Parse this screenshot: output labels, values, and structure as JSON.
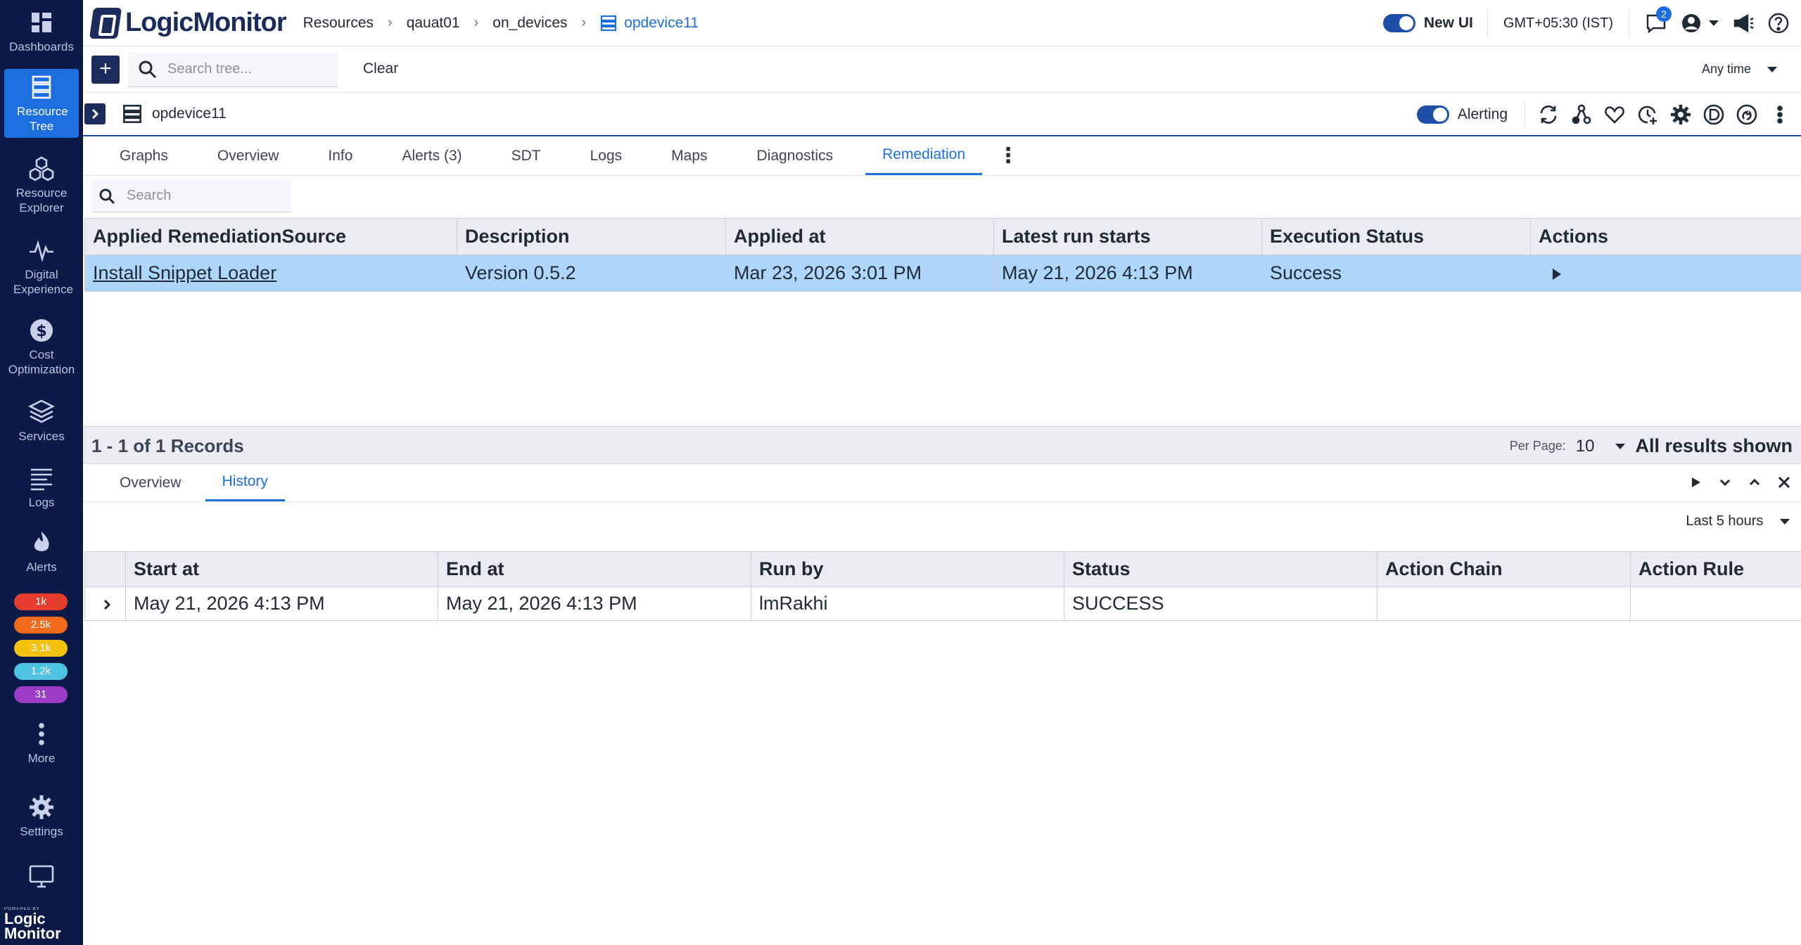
{
  "nav": {
    "items": [
      {
        "label": "Dashboards",
        "icon": "dashboards-icon"
      },
      {
        "label": "Resource Tree",
        "icon": "resource-tree-icon",
        "active": true
      },
      {
        "label": "Resource Explorer",
        "icon": "resource-explorer-icon"
      },
      {
        "label": "Digital Experience",
        "icon": "digital-experience-icon"
      },
      {
        "label": "Cost Optimization",
        "icon": "cost-optimization-icon"
      },
      {
        "label": "Services",
        "icon": "services-icon"
      },
      {
        "label": "Logs",
        "icon": "logs-icon"
      },
      {
        "label": "Alerts",
        "icon": "alerts-icon"
      },
      {
        "label": "More",
        "icon": "more-vertical-icon"
      },
      {
        "label": "Settings",
        "icon": "gear-icon"
      }
    ],
    "alert_badges": [
      {
        "count": "1k",
        "color": "#e53c2d"
      },
      {
        "count": "2.5k",
        "color": "#f26a1b"
      },
      {
        "count": "3.1k",
        "color": "#f4c20d"
      },
      {
        "count": "1.2k",
        "color": "#4cc3e3"
      },
      {
        "count": "31",
        "color": "#9c3bc3"
      }
    ],
    "powered_by": "POWERED BY",
    "powered_logo": "Logic Monitor"
  },
  "topbar": {
    "brand": "LogicMonitor",
    "breadcrumbs": [
      "Resources",
      "qauat01",
      "on_devices",
      "opdevice11"
    ],
    "new_ui_label": "New UI",
    "timezone": "GMT+05:30 (IST)",
    "notification_count": "2"
  },
  "searchrow": {
    "search_placeholder": "Search tree...",
    "clear_label": "Clear",
    "time_range": "Any time"
  },
  "device": {
    "name": "opdevice11",
    "alerting_label": "Alerting"
  },
  "tabs": [
    "Graphs",
    "Overview",
    "Info",
    "Alerts (3)",
    "SDT",
    "Logs",
    "Maps",
    "Diagnostics",
    "Remediation"
  ],
  "active_tab": "Remediation",
  "content_search_placeholder": "Search",
  "remediation_table": {
    "columns": [
      "Applied RemediationSource",
      "Description",
      "Applied at",
      "Latest run starts",
      "Execution Status",
      "Actions"
    ],
    "rows": [
      {
        "source": "Install Snippet Loader",
        "description": "Version 0.5.2",
        "applied_at": "Mar 23, 2026 3:01 PM",
        "latest_run": "May 21, 2026 4:13 PM",
        "status": "Success"
      }
    ]
  },
  "records": {
    "summary": "1 - 1 of 1 Records",
    "per_page_label": "Per Page:",
    "per_page_value": "10",
    "all_results": "All results shown"
  },
  "lower_panel": {
    "tabs": [
      "Overview",
      "History"
    ],
    "active_tab": "History",
    "time_range": "Last 5 hours"
  },
  "history_table": {
    "columns": [
      "",
      "Start at",
      "End at",
      "Run by",
      "Status",
      "Action Chain",
      "Action Rule"
    ],
    "rows": [
      {
        "start_at": "May 21, 2026 4:13 PM",
        "end_at": "May 21, 2026 4:13 PM",
        "run_by": "lmRakhi",
        "status": "SUCCESS",
        "action_chain": "",
        "action_rule": ""
      }
    ]
  }
}
